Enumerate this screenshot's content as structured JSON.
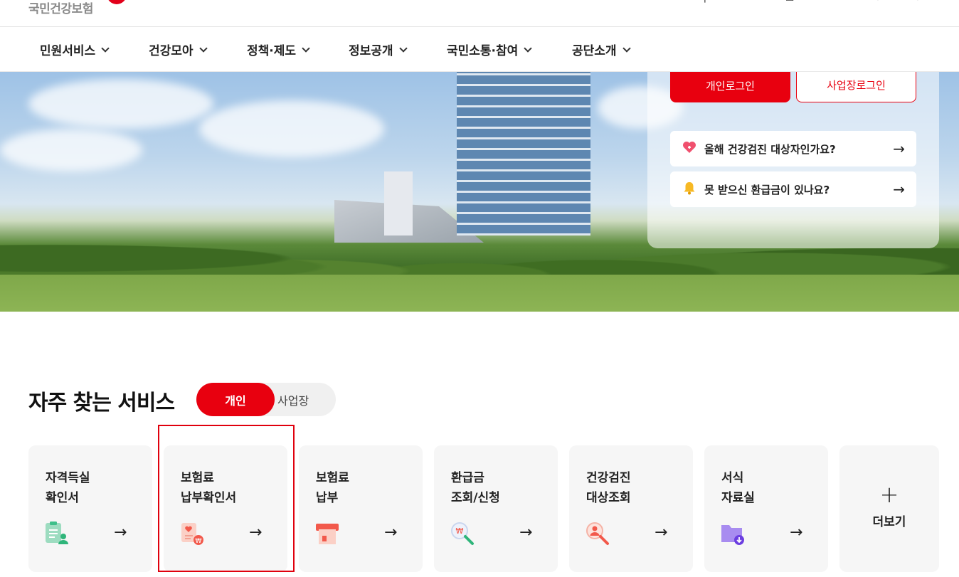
{
  "header": {
    "logo_text": "국민건강보험",
    "brand_color": "#e8000f"
  },
  "nav": {
    "items": [
      {
        "label": "민원서비스"
      },
      {
        "label": "건강모아"
      },
      {
        "label": "정책·제도"
      },
      {
        "label": "정보공개"
      },
      {
        "label": "국민소통·참여"
      },
      {
        "label": "공단소개"
      }
    ]
  },
  "login": {
    "personal_label": "개인로그인",
    "business_label": "사업장로그인",
    "quick_links": [
      {
        "icon": "heart-checkup-icon",
        "label": "올해 건강검진 대상자인가요?",
        "arrow": "→"
      },
      {
        "icon": "bell-icon",
        "label": "못 받으신 환급금이 있나요?",
        "arrow": "→"
      }
    ]
  },
  "services": {
    "title": "자주 찾는 서비스",
    "toggle": {
      "active": "개인",
      "inactive": "사업장"
    },
    "cards": [
      {
        "label": "자격득실\n확인서",
        "icon": "certificate-person-icon",
        "arrow": "→"
      },
      {
        "label": "보험료\n납부확인서",
        "icon": "payment-receipt-icon",
        "arrow": "→"
      },
      {
        "label": "보험료\n납부",
        "icon": "payment-terminal-icon",
        "arrow": "→"
      },
      {
        "label": "환급금\n조회/신청",
        "icon": "search-money-icon",
        "arrow": "→"
      },
      {
        "label": "건강검진\n대상조회",
        "icon": "person-search-icon",
        "arrow": "→"
      },
      {
        "label": "서식\n자료실",
        "icon": "folder-download-icon",
        "arrow": "→"
      }
    ],
    "more": {
      "plus": "+",
      "label": "더보기"
    }
  }
}
